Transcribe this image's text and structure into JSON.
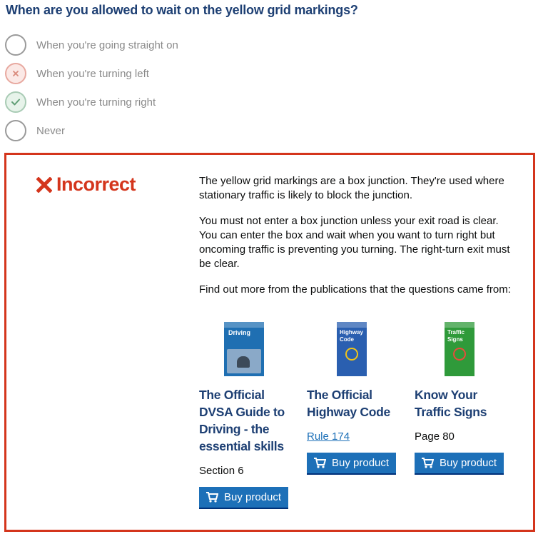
{
  "question": "When are you allowed to wait on the yellow grid markings?",
  "options": [
    {
      "label": "When you're going straight on",
      "state": "none"
    },
    {
      "label": "When you're turning left",
      "state": "wrong"
    },
    {
      "label": "When you're turning right",
      "state": "correct"
    },
    {
      "label": "Never",
      "state": "none"
    }
  ],
  "feedback": {
    "verdict": "Incorrect",
    "paragraphs": [
      "The yellow grid markings are a box junction. They're used where stationary traffic is likely to block the junction.",
      "You must not enter a box junction unless your exit road is clear. You can enter the box and wait when you want to turn right but oncoming traffic is preventing you turning. The right-turn exit must be clear.",
      "Find out more from the publications that the questions came from:"
    ],
    "publications": [
      {
        "title": "The Official DVSA Guide to Driving - the essential skills",
        "reference": "Section 6",
        "reference_is_link": false,
        "button": "Buy product",
        "cover_text": "Driving"
      },
      {
        "title": "The Official Highway Code",
        "reference": "Rule 174",
        "reference_is_link": true,
        "button": "Buy product",
        "cover_text": "Highway Code"
      },
      {
        "title": "Know Your Traffic Signs",
        "reference": "Page 80",
        "reference_is_link": false,
        "button": "Buy product",
        "cover_text": "Traffic Signs"
      }
    ]
  },
  "colors": {
    "title": "#1d3f73",
    "error": "#d4351c",
    "button": "#1d70b8",
    "link": "#1d70b8",
    "cover_1": "#1f6fb2",
    "cover_2": "#2a5fb0",
    "cover_3": "#2f9a3a"
  },
  "icons": {
    "wrong_mark": "cross-icon",
    "correct_mark": "check-icon",
    "verdict": "cross-icon",
    "button": "shopping-cart-icon"
  }
}
